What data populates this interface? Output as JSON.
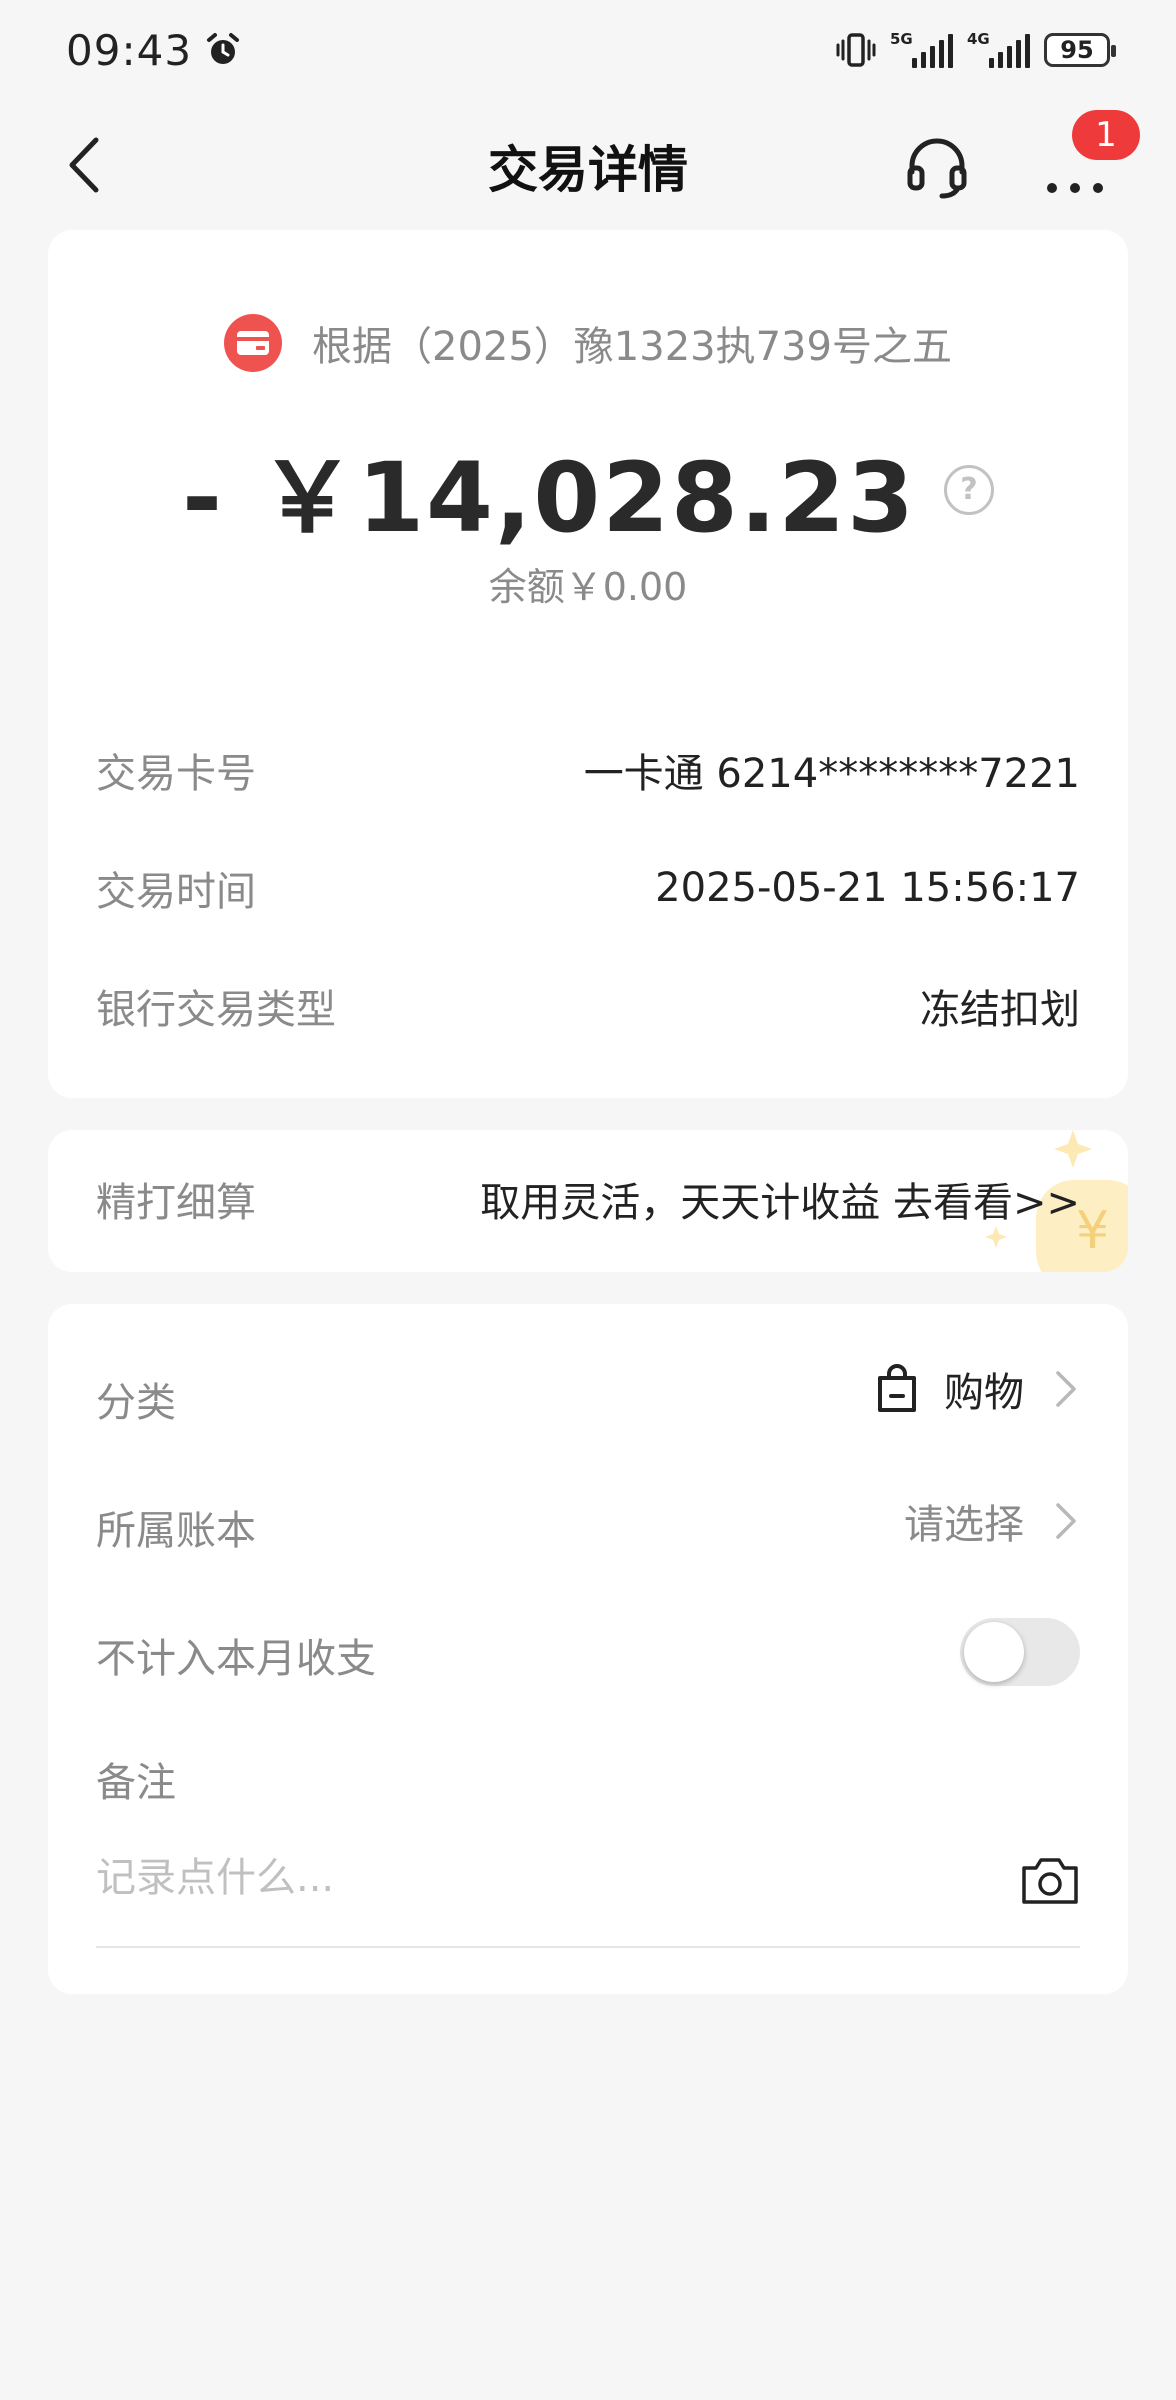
{
  "status_bar": {
    "time": "09:43",
    "net1": "5G",
    "net2": "4G",
    "battery": "95"
  },
  "nav": {
    "title": "交易详情",
    "badge_count": "1"
  },
  "transaction": {
    "merchant": "根据（2025）豫1323执739号之五",
    "amount": "- ￥14,028.23",
    "balance": "余额￥0.00",
    "help_glyph": "?"
  },
  "details": [
    {
      "label": "交易卡号",
      "value": "一卡通 6214********7221"
    },
    {
      "label": "交易时间",
      "value": "2025-05-21 15:56:17"
    },
    {
      "label": "银行交易类型",
      "value": "冻结扣划"
    }
  ],
  "promo": {
    "label": "精打细算",
    "text": "取用灵活，天天计收益 去看看>>"
  },
  "category": {
    "label": "分类",
    "value": "购物"
  },
  "ledger": {
    "label": "所属账本",
    "value": "请选择"
  },
  "exclude": {
    "label": "不计入本月收支",
    "enabled": false
  },
  "note": {
    "label": "备注",
    "placeholder": "记录点什么..."
  },
  "colors": {
    "background": "#f6f6f7",
    "accent_red": "#ef5350",
    "badge_red": "#ee3a3a",
    "muted_text": "#8a8a8a"
  },
  "icons": [
    "alarm-icon",
    "vibrate-icon",
    "signal-icon",
    "battery-icon",
    "back-icon",
    "headset-icon",
    "more-icon",
    "card-icon",
    "help-icon",
    "shopping-bag-icon",
    "chevron-right-icon",
    "camera-icon"
  ]
}
